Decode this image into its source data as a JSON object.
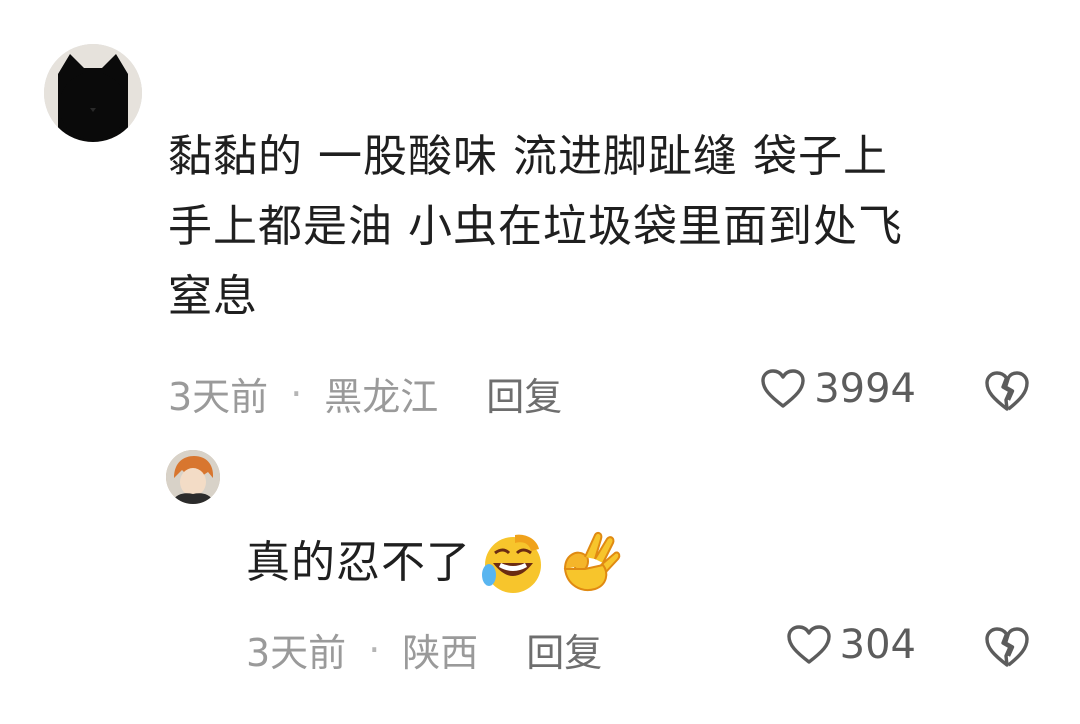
{
  "comments": [
    {
      "text_lines": [
        "黏黏的 一股酸味 流进脚趾缝 袋子上",
        "手上都是油 小虫在垃圾袋里面到处飞",
        "窒息"
      ],
      "time": "3天前",
      "separator": "·",
      "location": "黑龙江",
      "reply_label": "回复",
      "likes": "3994"
    },
    {
      "text": "真的忍不了",
      "emojis": [
        "rofl-emoji",
        "ok-hand-emoji"
      ],
      "time": "3天前",
      "separator": "·",
      "location": "陕西",
      "reply_label": "回复",
      "likes": "304"
    }
  ],
  "colors": {
    "meta": "#9a9a9a",
    "text": "#1f1f1f",
    "icon": "#5c5c5c"
  }
}
